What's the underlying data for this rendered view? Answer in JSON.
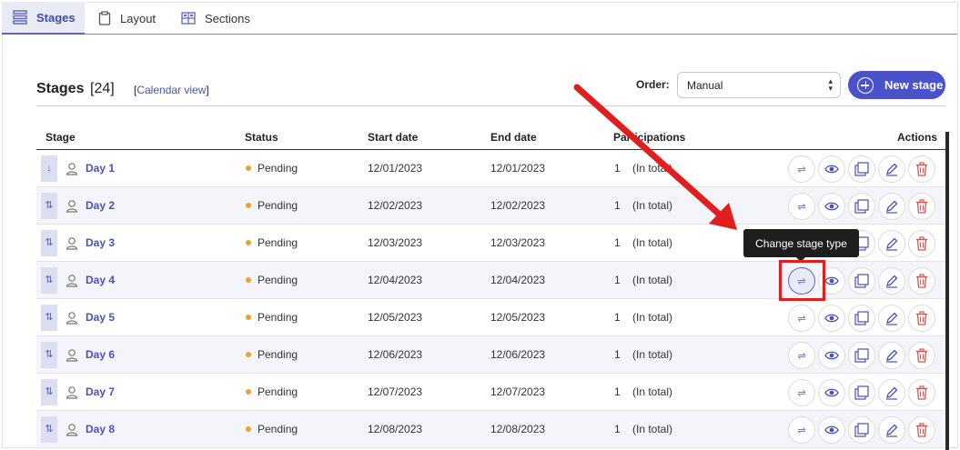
{
  "tabs": [
    {
      "label": "Stages",
      "icon": "stack-icon",
      "active": true
    },
    {
      "label": "Layout",
      "icon": "clipboard-icon",
      "active": false
    },
    {
      "label": "Sections",
      "icon": "grid-icon",
      "active": false
    }
  ],
  "header": {
    "title": "Stages",
    "count": "[24]",
    "calendar_link_open": "[",
    "calendar_link": "Calendar view",
    "calendar_link_close": "]",
    "order_label": "Order:",
    "order_value": "Manual",
    "new_stage_label": "New stage"
  },
  "table": {
    "columns": {
      "stage": "Stage",
      "status": "Status",
      "start": "Start date",
      "end": "End date",
      "participations": "Participations",
      "actions": "Actions"
    },
    "rows": [
      {
        "name": "Day 1",
        "status": "Pending",
        "start": "12/01/2023",
        "end": "12/01/2023",
        "participations": "1",
        "note": "(In total)",
        "handle": "↓"
      },
      {
        "name": "Day 2",
        "status": "Pending",
        "start": "12/02/2023",
        "end": "12/02/2023",
        "participations": "1",
        "note": "(In total)",
        "handle": "⇅"
      },
      {
        "name": "Day 3",
        "status": "Pending",
        "start": "12/03/2023",
        "end": "12/03/2023",
        "participations": "1",
        "note": "(In total)",
        "handle": "⇅"
      },
      {
        "name": "Day 4",
        "status": "Pending",
        "start": "12/04/2023",
        "end": "12/04/2023",
        "participations": "1",
        "note": "(In total)",
        "handle": "⇅"
      },
      {
        "name": "Day 5",
        "status": "Pending",
        "start": "12/05/2023",
        "end": "12/05/2023",
        "participations": "1",
        "note": "(In total)",
        "handle": "⇅"
      },
      {
        "name": "Day 6",
        "status": "Pending",
        "start": "12/06/2023",
        "end": "12/06/2023",
        "participations": "1",
        "note": "(In total)",
        "handle": "⇅"
      },
      {
        "name": "Day 7",
        "status": "Pending",
        "start": "12/07/2023",
        "end": "12/07/2023",
        "participations": "1",
        "note": "(In total)",
        "handle": "⇅"
      },
      {
        "name": "Day 8",
        "status": "Pending",
        "start": "12/08/2023",
        "end": "12/08/2023",
        "participations": "1",
        "note": "(In total)",
        "handle": "⇅"
      }
    ],
    "action_icons": [
      "swap-icon",
      "eye-icon",
      "duplicate-icon",
      "pencil-icon",
      "trash-icon"
    ]
  },
  "tooltip": {
    "text": "Change stage type"
  },
  "colors": {
    "accent": "#4a52c9",
    "status_pending": "#f0a02a",
    "delete": "#d9534f",
    "highlight": "#e21d1d"
  }
}
